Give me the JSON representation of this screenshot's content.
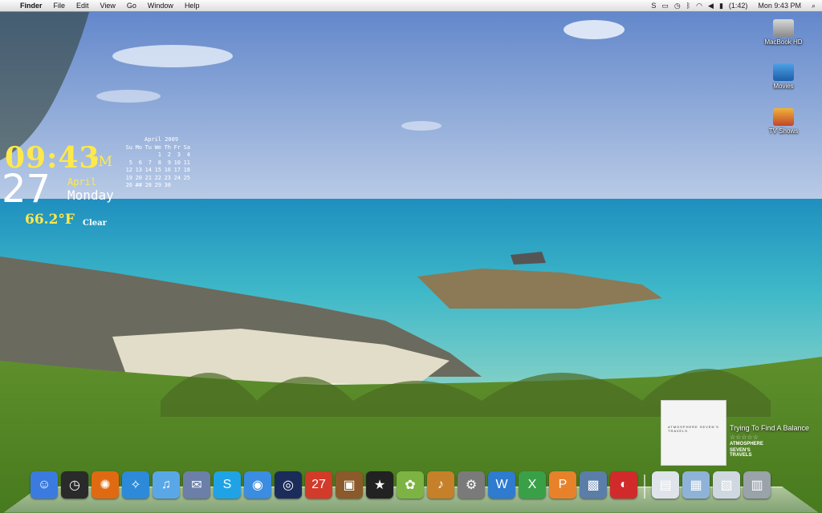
{
  "menubar": {
    "apple": "",
    "app_name": "Finder",
    "menus": [
      "File",
      "Edit",
      "View",
      "Go",
      "Window",
      "Help"
    ],
    "battery": "(1:42)",
    "clock": "Mon 9:43 PM"
  },
  "desktop_icons": [
    {
      "label": "MacBook HD"
    },
    {
      "label": "Movies"
    },
    {
      "label": "TV Shows"
    }
  ],
  "clock_widget": {
    "time": "09:43",
    "ampm": "PM",
    "day": "27",
    "month": "April",
    "weekday": "Monday",
    "temperature": "66.2°F",
    "condition": "Clear"
  },
  "calendar_widget": {
    "title": "April 2009",
    "headers": [
      "Su",
      "Mo",
      "Tu",
      "We",
      "Th",
      "Fr",
      "Sa"
    ],
    "weeks": [
      [
        "",
        "",
        "",
        "1",
        "2",
        "3",
        "4"
      ],
      [
        "5",
        "6",
        "7",
        "8",
        "9",
        "10",
        "11"
      ],
      [
        "12",
        "13",
        "14",
        "15",
        "16",
        "17",
        "18"
      ],
      [
        "19",
        "20",
        "21",
        "22",
        "23",
        "24",
        "25"
      ],
      [
        "26",
        "##",
        "28",
        "29",
        "30",
        "",
        ""
      ]
    ]
  },
  "now_playing": {
    "title": "Trying To Find A Balance",
    "rating": "☆☆☆☆☆",
    "artist": "ATMOSPHERE",
    "album": "SEVEN'S TRAVELS",
    "cover_text": "ATMOSPHERE SEVEN'S TRAVELS"
  },
  "dock": {
    "apps": [
      {
        "icon": "finder-icon",
        "glyph": "☺",
        "color": "#3b7be0"
      },
      {
        "icon": "dashboard-icon",
        "glyph": "◷",
        "color": "#2a2a2a"
      },
      {
        "icon": "firefox-icon",
        "glyph": "✺",
        "color": "#e06a12"
      },
      {
        "icon": "safari-icon",
        "glyph": "✧",
        "color": "#2d8ad8"
      },
      {
        "icon": "itunes-icon",
        "glyph": "♫",
        "color": "#5aa7e8"
      },
      {
        "icon": "mail-stamp-icon",
        "glyph": "✉",
        "color": "#6b7fa8"
      },
      {
        "icon": "skype-icon",
        "glyph": "S",
        "color": "#1fa3e6"
      },
      {
        "icon": "ichat-icon",
        "glyph": "◉",
        "color": "#3a8de0"
      },
      {
        "icon": "dvd-player-icon",
        "glyph": "◎",
        "color": "#1c2c5a"
      },
      {
        "icon": "ical-icon",
        "glyph": "27",
        "color": "#d23a2a"
      },
      {
        "icon": "iphoto-icon",
        "glyph": "▣",
        "color": "#8a5a2a"
      },
      {
        "icon": "imovie-icon",
        "glyph": "★",
        "color": "#222"
      },
      {
        "icon": "adium-icon",
        "glyph": "✿",
        "color": "#7cb342"
      },
      {
        "icon": "garageband-icon",
        "glyph": "♪",
        "color": "#c6802a"
      },
      {
        "icon": "system-preferences-icon",
        "glyph": "⚙",
        "color": "#7a7a7a"
      },
      {
        "icon": "word-icon",
        "glyph": "W",
        "color": "#2e7bd0"
      },
      {
        "icon": "excel-icon",
        "glyph": "X",
        "color": "#3aa048"
      },
      {
        "icon": "powerpoint-icon",
        "glyph": "P",
        "color": "#e8822a"
      },
      {
        "icon": "preview-icon",
        "glyph": "▩",
        "color": "#5b7ea8"
      },
      {
        "icon": "toaster-icon",
        "glyph": "◐",
        "color": "#d12a2a"
      }
    ],
    "others": [
      {
        "icon": "doc-file-icon",
        "glyph": "▤",
        "color": "#dfe4ea"
      },
      {
        "icon": "applications-folder-icon",
        "glyph": "▦",
        "color": "#8fb3d8"
      },
      {
        "icon": "downloads-stack-icon",
        "glyph": "▧",
        "color": "#cfd8e0"
      },
      {
        "icon": "trash-icon",
        "glyph": "▥",
        "color": "#9aa2aa"
      }
    ]
  }
}
